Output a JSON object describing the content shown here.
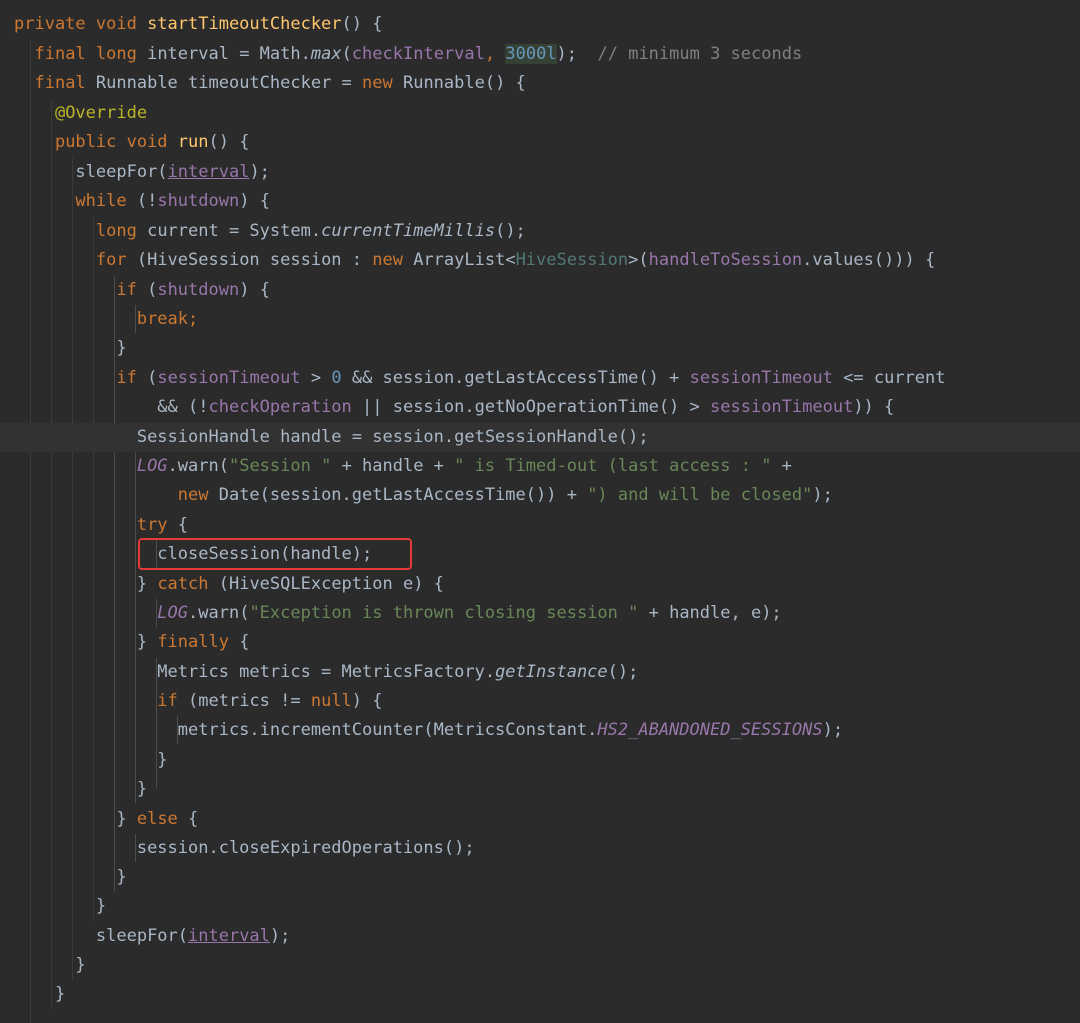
{
  "editor": {
    "language": "Java",
    "theme_colors": {
      "background": "#2b2b2b",
      "keyword": "#cc7832",
      "method_declaration": "#ffc66d",
      "field": "#9876aa",
      "string": "#6a8759",
      "number": "#6897bb",
      "comment": "#808080",
      "annotation": "#bbb529",
      "highlight_box": "#e53935"
    }
  },
  "code": {
    "l1": [
      "private void ",
      "startTimeoutChecker",
      "() {"
    ],
    "l2": [
      "final long ",
      "interval = Math.",
      "max",
      "(",
      "checkInterval",
      ", ",
      "3000l",
      ");  ",
      "// minimum 3 seconds"
    ],
    "l3": [
      "final ",
      "Runnable timeoutChecker = ",
      "new ",
      "Runnable() {"
    ],
    "l4": [
      "@Override"
    ],
    "l5": [
      "public void ",
      "run",
      "() {"
    ],
    "l6": [
      "sleepFor(",
      "interval",
      ");"
    ],
    "l7": [
      "while ",
      "(!",
      "shutdown",
      ") {"
    ],
    "l8": [
      "long ",
      "current = System.",
      "currentTimeMillis",
      "();"
    ],
    "l9": [
      "for ",
      "(HiveSession session : ",
      "new ",
      "ArrayList<",
      "HiveSession",
      ">(",
      "handleToSession",
      ".values())) {"
    ],
    "l10": [
      "if ",
      "(",
      "shutdown",
      ") {"
    ],
    "l11": [
      "break;"
    ],
    "l12": [
      "}"
    ],
    "l13": [
      "if ",
      "(",
      "sessionTimeout",
      " > ",
      "0",
      " && session.getLastAccessTime() + ",
      "sessionTimeout",
      " <= current"
    ],
    "l14": [
      "&& (!",
      "checkOperation",
      " || session.getNoOperationTime() > ",
      "sessionTimeout",
      ")) {"
    ],
    "l15": [
      "SessionHandle handle = session.getSessionHandle();"
    ],
    "l16": [
      "LOG",
      ".warn(",
      "\"Session \"",
      " + handle + ",
      "\" is Timed-out (last access : \"",
      " +"
    ],
    "l17": [
      "new ",
      "Date(session.getLastAccessTime()) + ",
      "\") and will be closed\"",
      ");"
    ],
    "l18": [
      "try ",
      "{"
    ],
    "l19": [
      "closeSession(handle);"
    ],
    "l20": [
      "} ",
      "catch ",
      "(HiveSQLException e) {"
    ],
    "l21": [
      "LOG",
      ".warn(",
      "\"Exception is thrown closing session \"",
      " + handle, e);"
    ],
    "l22": [
      "} ",
      "finally ",
      "{"
    ],
    "l23": [
      "Metrics metrics = MetricsFactory.",
      "getInstance",
      "();"
    ],
    "l24": [
      "if ",
      "(metrics != ",
      "null",
      ") {"
    ],
    "l25": [
      "metrics.incrementCounter(MetricsConstant.",
      "HS2_ABANDONED_SESSIONS",
      ");"
    ],
    "l26": [
      "}"
    ],
    "l27": [
      "}"
    ],
    "l28": [
      "} ",
      "else ",
      "{"
    ],
    "l29": [
      "session.closeExpiredOperations();"
    ],
    "l30": [
      "}"
    ],
    "l31": [
      "}"
    ],
    "l32": [
      "sleepFor(",
      "interval",
      ");"
    ],
    "l33": [
      "}"
    ],
    "l34": [
      "}"
    ]
  }
}
